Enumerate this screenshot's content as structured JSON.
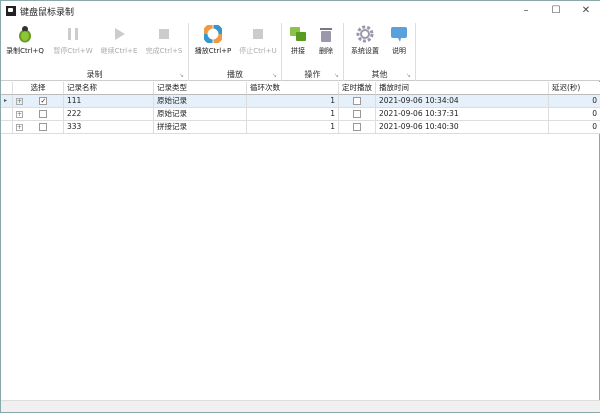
{
  "window": {
    "title": "键盘鼠标录制",
    "minimize": "–",
    "maximize": "☐",
    "close": "✕"
  },
  "ribbon": {
    "groups": [
      {
        "label": "录制"
      },
      {
        "label": "播放"
      },
      {
        "label": "操作"
      },
      {
        "label": "其他"
      }
    ],
    "buttons": {
      "record": "录制Ctrl+Q",
      "pause": "暂停Ctrl+W",
      "resume": "继续Ctrl+E",
      "finish": "完成Ctrl+S",
      "play": "播放Ctrl+P",
      "stop": "停止Ctrl+U",
      "merge": "拼接",
      "delete": "删除",
      "settings": "系统设置",
      "help": "说明"
    }
  },
  "grid": {
    "columns": [
      "选择",
      "记录名称",
      "记录类型",
      "循环次数",
      "定时播放",
      "播放时间",
      "延迟(秒)"
    ],
    "rows": [
      {
        "selected": true,
        "name": "111",
        "type": "原始记录",
        "loops": "1",
        "scheduled": false,
        "time": "2021-09-06 10:34:04",
        "delay": "0"
      },
      {
        "selected": false,
        "name": "222",
        "type": "原始记录",
        "loops": "1",
        "scheduled": false,
        "time": "2021-09-06 10:37:31",
        "delay": "0"
      },
      {
        "selected": false,
        "name": "333",
        "type": "拼接记录",
        "loops": "1",
        "scheduled": false,
        "time": "2021-09-06 10:40:30",
        "delay": "0"
      }
    ]
  }
}
